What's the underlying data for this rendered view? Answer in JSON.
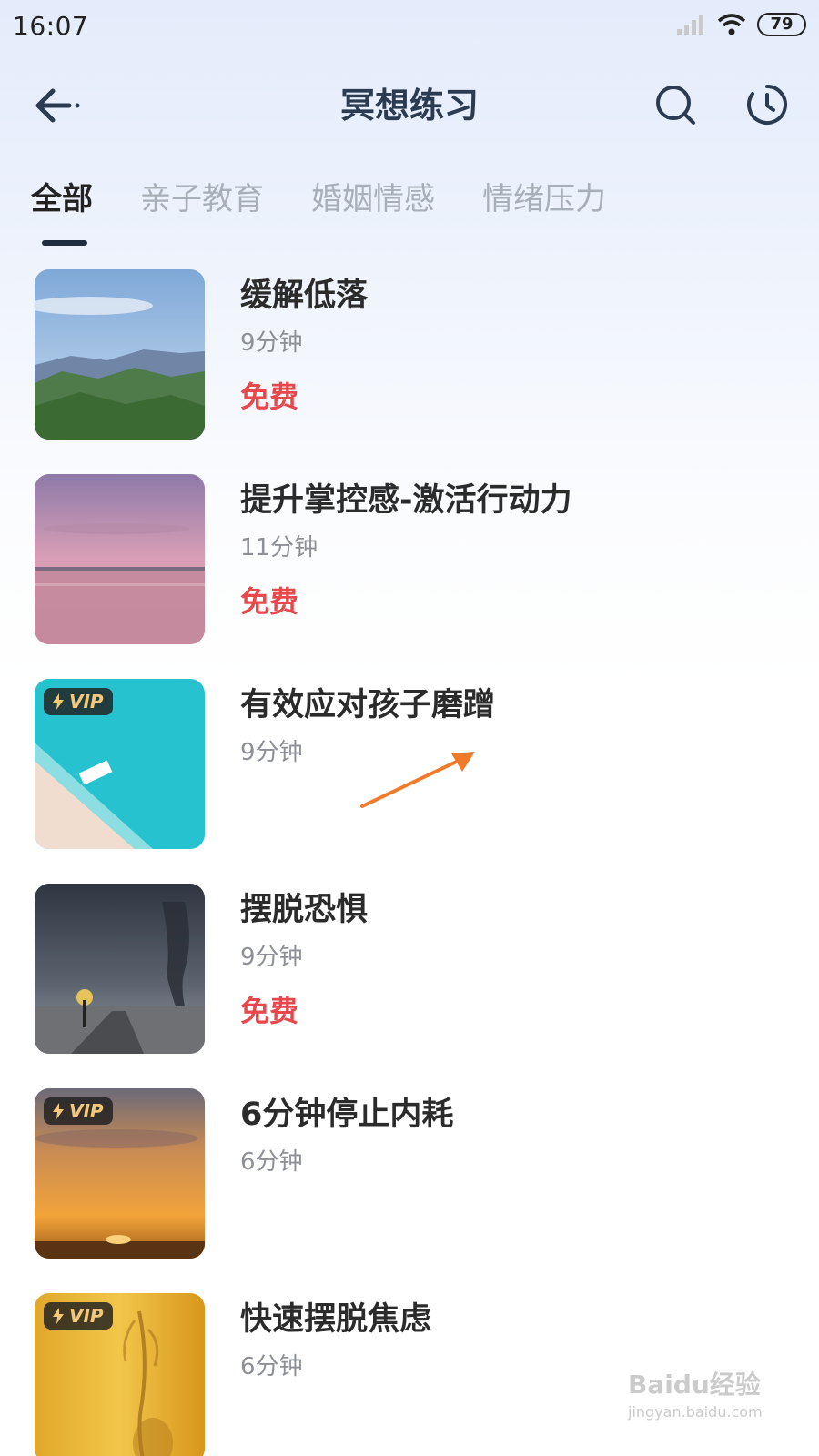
{
  "status_bar": {
    "time": "16:07",
    "battery": "79",
    "icons": [
      "signal-icon",
      "wifi-icon",
      "battery-icon"
    ]
  },
  "nav": {
    "title": "冥想练习",
    "back_icon": "back-arrow-icon",
    "search_icon": "search-icon",
    "history_icon": "history-clock-icon"
  },
  "tabs": [
    {
      "label": "全部",
      "active": true
    },
    {
      "label": "亲子教育",
      "active": false
    },
    {
      "label": "婚姻情感",
      "active": false
    },
    {
      "label": "情绪压力",
      "active": false
    }
  ],
  "items": [
    {
      "title": "缓解低落",
      "duration": "9分钟",
      "price": "免费",
      "vip": false,
      "image": "mountain-landscape"
    },
    {
      "title": "提升掌控感-激活行动力",
      "duration": "11分钟",
      "price": "免费",
      "vip": false,
      "image": "pink-sea-sunset"
    },
    {
      "title": "有效应对孩子磨蹭",
      "duration": "9分钟",
      "price": "",
      "vip": true,
      "vip_label": "VIP",
      "image": "turquoise-beach-boat"
    },
    {
      "title": "摆脱恐惧",
      "duration": "9分钟",
      "price": "免费",
      "vip": false,
      "image": "tornado-storm"
    },
    {
      "title": "6分钟停止内耗",
      "duration": "6分钟",
      "price": "",
      "vip": true,
      "vip_label": "VIP",
      "image": "orange-sunset"
    },
    {
      "title": "快速摆脱焦虑",
      "duration": "6分钟",
      "price": "",
      "vip": true,
      "vip_label": "VIP",
      "image": "golden-plant-shadow"
    }
  ],
  "annotation": {
    "arrow_color": "#f07a2a"
  },
  "watermark": {
    "brand": "Baidu经验",
    "url": "jingyan.baidu.com"
  },
  "colors": {
    "accent_price": "#e8474c",
    "title": "#2a3b52",
    "tab_inactive": "#a9afb8"
  }
}
